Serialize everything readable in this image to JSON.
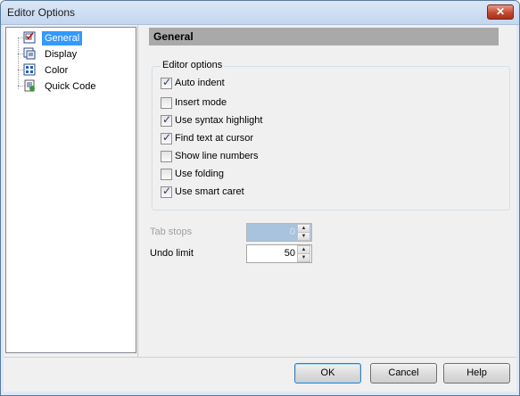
{
  "window": {
    "title": "Editor Options",
    "close_label": "✕"
  },
  "tree": {
    "items": [
      {
        "label": "General",
        "icon": "general-settings-icon",
        "selected": true
      },
      {
        "label": "Display",
        "icon": "display-settings-icon",
        "selected": false
      },
      {
        "label": "Color",
        "icon": "color-palette-icon",
        "selected": false
      },
      {
        "label": "Quick Code",
        "icon": "quick-code-icon",
        "selected": false
      }
    ]
  },
  "panel": {
    "header": "General",
    "group_title": "Editor options",
    "options": [
      {
        "label": "Auto indent",
        "checked": true
      },
      {
        "label": "Insert mode",
        "checked": false
      },
      {
        "label": "Use syntax highlight",
        "checked": true
      },
      {
        "label": "Find text at cursor",
        "checked": true
      },
      {
        "label": "Show line numbers",
        "checked": false
      },
      {
        "label": "Use folding",
        "checked": false
      },
      {
        "label": "Use smart caret",
        "checked": true
      }
    ],
    "tab_stops": {
      "label": "Tab stops",
      "value": "0",
      "enabled": false
    },
    "undo_limit": {
      "label": "Undo limit",
      "value": "50",
      "enabled": true
    }
  },
  "buttons": {
    "ok": {
      "label": "OK",
      "mnemonic": "O"
    },
    "cancel": {
      "label": "Cancel",
      "mnemonic": "C"
    },
    "help": {
      "label": "Help",
      "mnemonic": "H"
    }
  },
  "colors": {
    "selection": "#3399ff",
    "header_band": "#a9a9a9",
    "disabled_field": "#a9c3df"
  }
}
